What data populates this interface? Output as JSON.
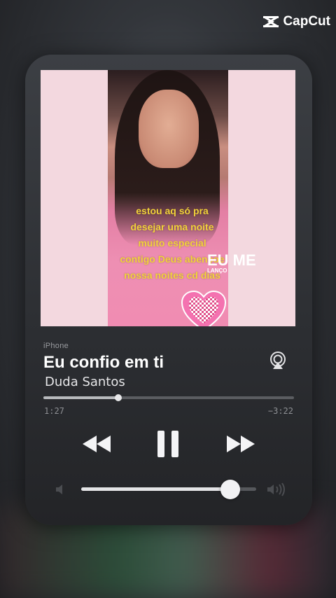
{
  "watermark": {
    "brand": "CapCut",
    "icon": "capcut-logo-icon"
  },
  "artwork": {
    "overlay_lines": [
      "estou aq só pra",
      "desejar uma noite",
      "muito especial",
      "contigo Deus abençoe",
      "nossa noites  cd dias"
    ],
    "badge_title": "EU ME",
    "badge_sub": "LANÇO",
    "sticker_icon": "pink-heart-icon"
  },
  "player": {
    "source": "iPhone",
    "title": "Eu confio em ti",
    "artist": "Duda Santos",
    "airplay_icon": "airplay-icon",
    "progress": {
      "elapsed": "1:27",
      "remaining": "−3:22",
      "fraction": 0.3
    },
    "controls": {
      "rewind_icon": "rewind-icon",
      "pause_icon": "pause-icon",
      "forward_icon": "fast-forward-icon"
    },
    "volume": {
      "level": 0.85,
      "min_icon": "volume-low-icon",
      "max_icon": "volume-high-icon"
    }
  },
  "colors": {
    "overlay_text": "#f2d23a",
    "artwork_bg": "#f3d8df",
    "card_bg": "#2c2e32"
  }
}
